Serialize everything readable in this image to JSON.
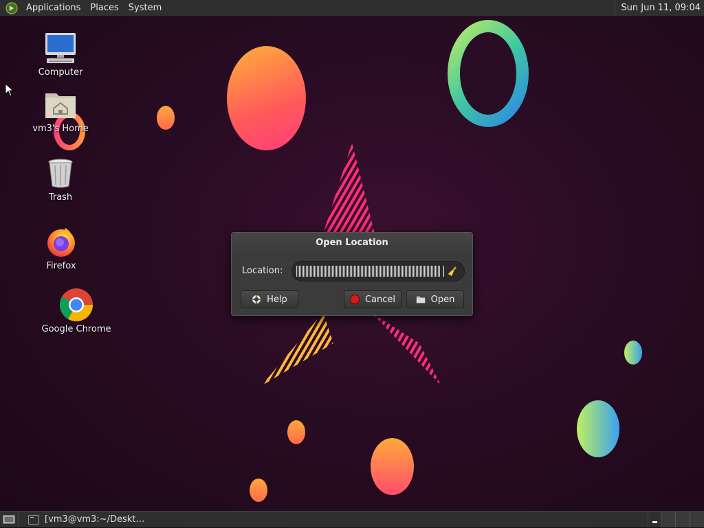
{
  "top_panel": {
    "menus": [
      "Applications",
      "Places",
      "System"
    ],
    "clock": "Sun Jun 11, 09:04"
  },
  "desktop": {
    "icons": [
      {
        "label": "Computer",
        "icon": "computer-icon"
      },
      {
        "label": "vm3's Home",
        "icon": "home-folder-icon"
      },
      {
        "label": "Trash",
        "icon": "trash-icon"
      },
      {
        "label": "Firefox",
        "icon": "firefox-icon"
      },
      {
        "label": "Google Chrome",
        "icon": "chrome-icon"
      }
    ]
  },
  "dialog": {
    "title": "Open Location",
    "location_label": "Location:",
    "location_value": "",
    "help_label": "Help",
    "cancel_label": "Cancel",
    "open_label": "Open"
  },
  "bottom_panel": {
    "task_label": "[vm3@vm3:~/Deskt…"
  },
  "colors": {
    "panel_bg": "#2f2f2f",
    "dialog_bg": "#3b3b3b",
    "desktop_bg": "#2a0c24",
    "accent_pink": "#ff2d7a",
    "accent_orange": "#ff9a3c"
  }
}
